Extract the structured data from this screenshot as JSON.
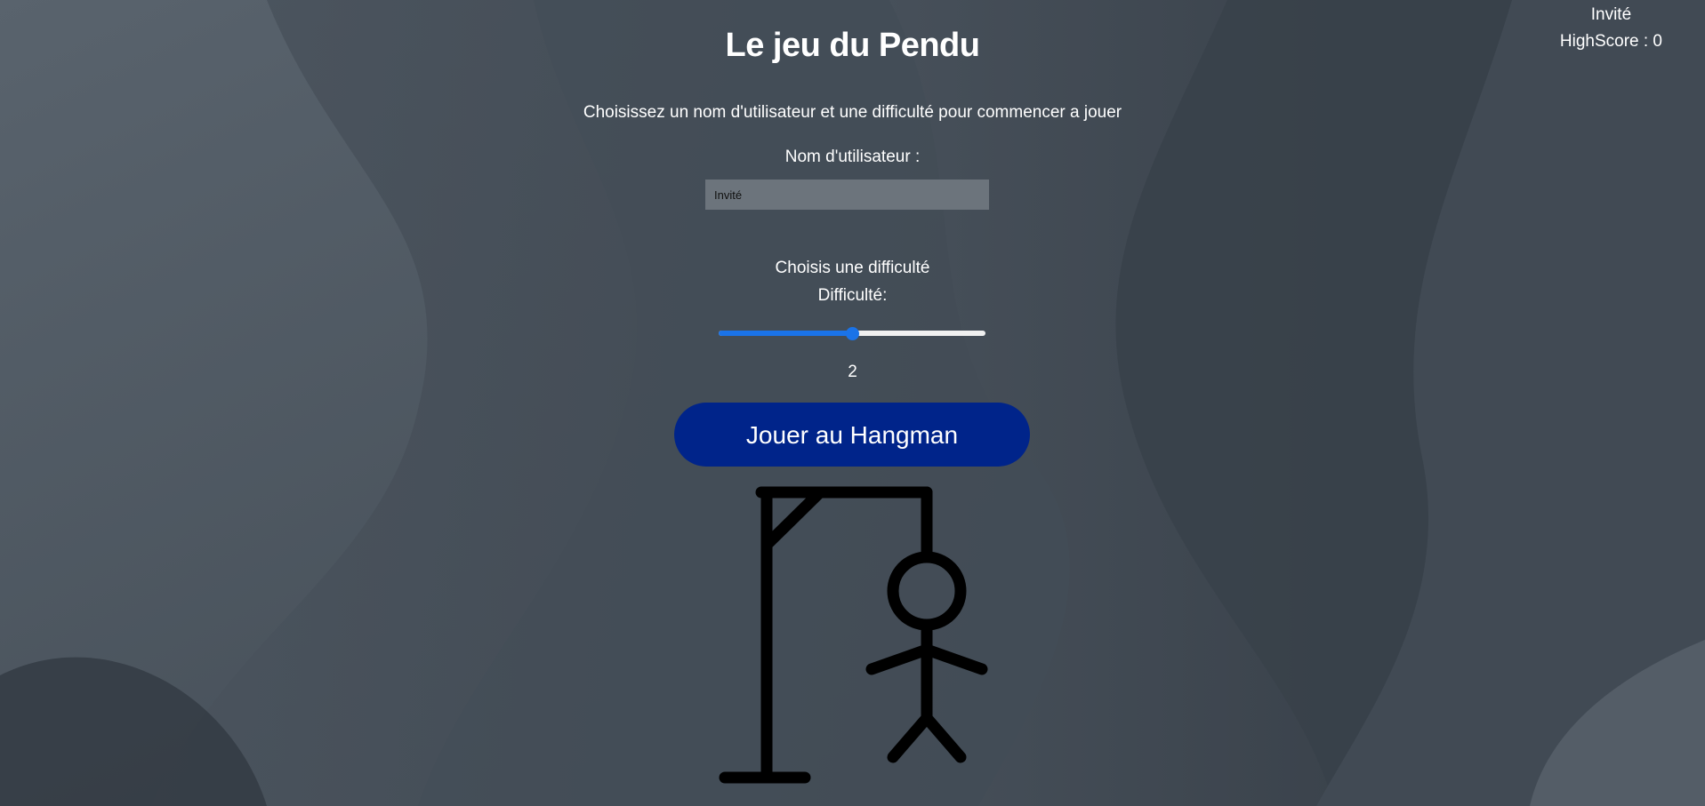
{
  "header": {
    "username": "Invité",
    "highscore": "HighScore : 0"
  },
  "main": {
    "title": "Le jeu du Pendu",
    "subtitle": "Choisissez un nom d'utilisateur et une difficulté pour commencer a jouer",
    "username_label": "Nom d'utilisateur :",
    "username_value": "Invité",
    "choose_difficulty": "Choisis une difficulté",
    "difficulty_label": "Difficulté:",
    "difficulty": {
      "value": "2",
      "min": 0,
      "max": 4,
      "fraction": 0.5
    },
    "play_button": "Jouer au Hangman"
  },
  "colors": {
    "background": "#3f4852",
    "button": "#00248a",
    "slider_accent": "#1a73e8",
    "input_background": "#6c747c",
    "hangman_stroke": "#000000"
  },
  "icons": {
    "hangman_figure": "hangman-icon"
  }
}
